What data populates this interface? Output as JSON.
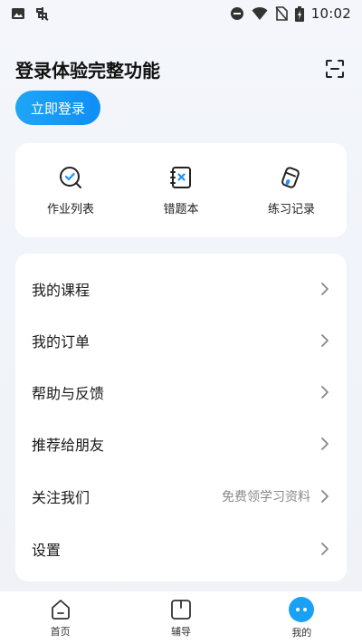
{
  "status_bar": {
    "time": "10:02",
    "left_icons": [
      "image-icon",
      "app-notification-icon"
    ],
    "right_icons": [
      "do-not-disturb-icon",
      "wifi-icon",
      "no-sim-icon",
      "battery-charging-icon"
    ]
  },
  "header": {
    "title": "登录体验完整功能",
    "scan_icon": "scan-icon",
    "login_button": "立即登录"
  },
  "quick_actions": [
    {
      "label": "作业列表",
      "icon": "homework-list-icon"
    },
    {
      "label": "错题本",
      "icon": "mistake-book-icon"
    },
    {
      "label": "练习记录",
      "icon": "practice-record-icon"
    }
  ],
  "menu": [
    {
      "label": "我的课程",
      "hint": ""
    },
    {
      "label": "我的订单",
      "hint": ""
    },
    {
      "label": "帮助与反馈",
      "hint": ""
    },
    {
      "label": "推荐给朋友",
      "hint": ""
    },
    {
      "label": "关注我们",
      "hint": "免费领学习资料"
    },
    {
      "label": "设置",
      "hint": ""
    }
  ],
  "tabbar": [
    {
      "label": "首页",
      "icon": "home-icon",
      "active": false
    },
    {
      "label": "辅导",
      "icon": "tutoring-icon",
      "active": false
    },
    {
      "label": "我的",
      "icon": "profile-icon",
      "active": true
    }
  ],
  "colors": {
    "accent": "#1aa0f5",
    "login_gradient_start": "#1ea6f6",
    "login_gradient_end": "#0f8ef4",
    "icon_blue": "#1e90ff"
  }
}
